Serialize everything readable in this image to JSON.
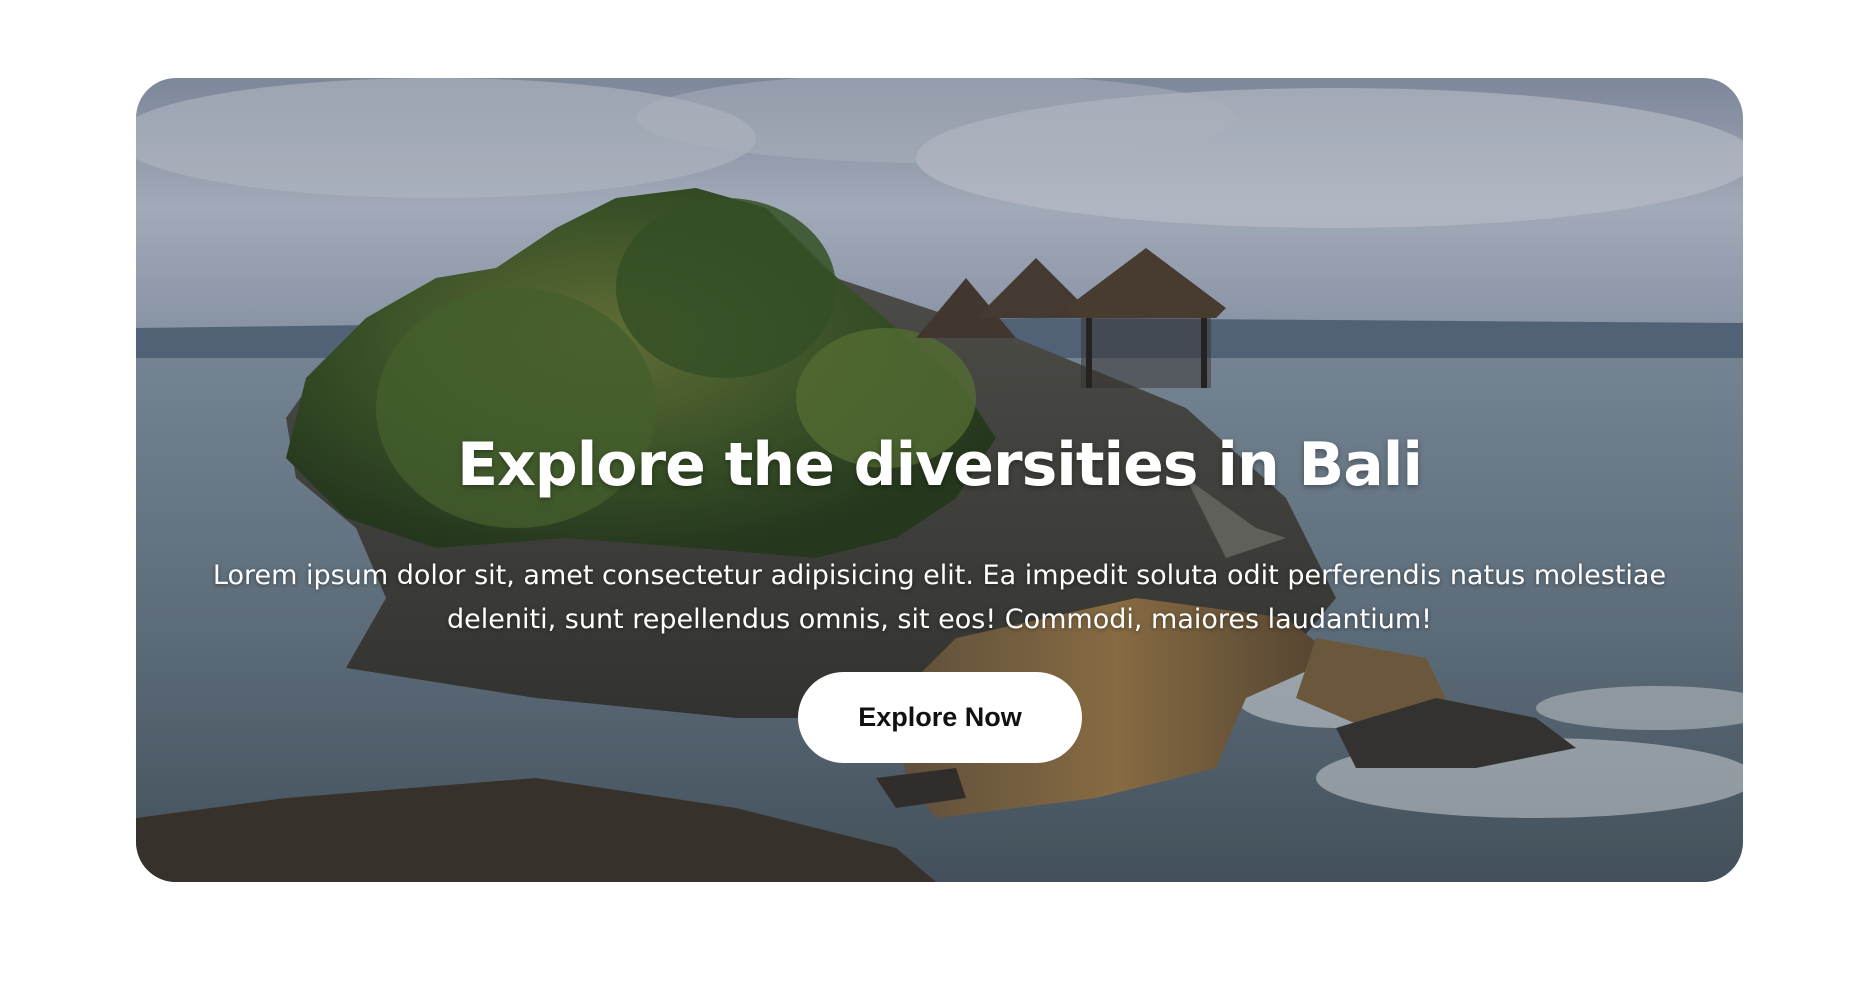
{
  "hero": {
    "title": "Explore the diversities in Bali",
    "description": "Lorem ipsum dolor sit, amet consectetur adipisicing elit. Ea impedit soluta odit perferendis natus molestiae deleniti, sunt repellendus omnis, sit eos! Commodi, maiores laudantium!",
    "button_label": "Explore Now",
    "background_image": "bali-temple-on-rock-by-sea"
  },
  "colors": {
    "page_background": "#ffffff",
    "text": "#ffffff",
    "button_background": "#ffffff",
    "button_text": "#111111"
  }
}
